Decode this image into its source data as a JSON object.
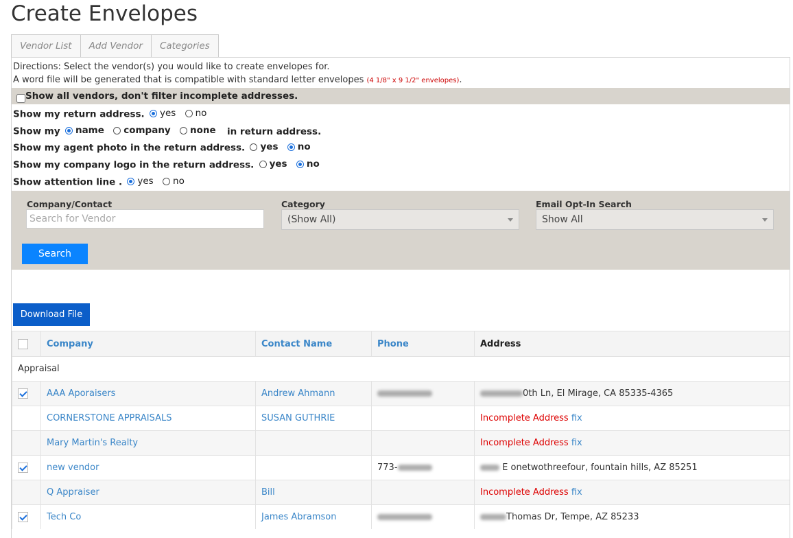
{
  "page": {
    "title": "Create Envelopes"
  },
  "tabs": [
    "Vendor List",
    "Add Vendor",
    "Categories"
  ],
  "directions": {
    "line1": "Directions: Select the vendor(s) you would like to create envelopes for.",
    "line2": "A word file will be generated that is compatible with standard letter envelopes",
    "size_note": "(4 1/8\" x 9 1/2\" envelopes)",
    "period": "."
  },
  "filter": {
    "label": "Show all vendors, don't filter incomplete addresses.",
    "checked": false
  },
  "options": {
    "return_address": {
      "label": "Show my return address.",
      "yes": "yes",
      "no": "no",
      "selected": "yes"
    },
    "show_my": {
      "prefix": "Show my",
      "name": "name",
      "company": "company",
      "none": "none",
      "suffix": "in return address.",
      "selected": "name"
    },
    "agent_photo": {
      "label": "Show my agent photo in the return address.",
      "yes": "yes",
      "no": "no",
      "selected": "no"
    },
    "company_logo": {
      "label": "Show my company logo in the return address.",
      "yes": "yes",
      "no": "no",
      "selected": "no"
    },
    "attention_line": {
      "label": "Show attention line .",
      "yes": "yes",
      "no": "no",
      "selected": "yes"
    }
  },
  "search": {
    "company_label": "Company/Contact",
    "company_placeholder": "Search for Vendor",
    "category_label": "Category",
    "category_value": "(Show All)",
    "optin_label": "Email Opt-In Search",
    "optin_value": "Show All",
    "button": "Search"
  },
  "download_button": "Download File",
  "table": {
    "headers": {
      "company": "Company",
      "contact": "Contact Name",
      "phone": "Phone",
      "address": "Address"
    },
    "group": "Appraisal",
    "incomplete_text": "Incomplete Address",
    "fix_text": "fix",
    "rows": [
      {
        "checked": true,
        "company": "AAA Aporaisers",
        "contact": "Andrew Ahmann",
        "phone": "",
        "address": "0th Ln, El Mirage, CA 85335-4365",
        "incomplete": false
      },
      {
        "checked": false,
        "company": "CORNERSTONE APPRAISALS",
        "contact": "SUSAN GUTHRIE",
        "phone": "",
        "address": "",
        "incomplete": true
      },
      {
        "checked": false,
        "company": "Mary Martin's Realty",
        "contact": "",
        "phone": "",
        "address": "",
        "incomplete": true
      },
      {
        "checked": true,
        "company": "new vendor",
        "contact": "",
        "phone": "773-",
        "address": "E onetwothreefour, fountain hills, AZ 85251",
        "incomplete": false
      },
      {
        "checked": false,
        "company": "Q Appraiser",
        "contact": "Bill",
        "phone": "",
        "address": "",
        "incomplete": true
      },
      {
        "checked": true,
        "company": "Tech Co",
        "contact": "James Abramson",
        "phone": "",
        "address": "Thomas Dr, Tempe, AZ 85233",
        "incomplete": false
      }
    ]
  },
  "colors": {
    "link": "#3a86c8",
    "primary_button": "#0a84ff",
    "download_button": "#0b5ec9",
    "error": "#d00000",
    "panel_bg": "#d8d4cd"
  }
}
